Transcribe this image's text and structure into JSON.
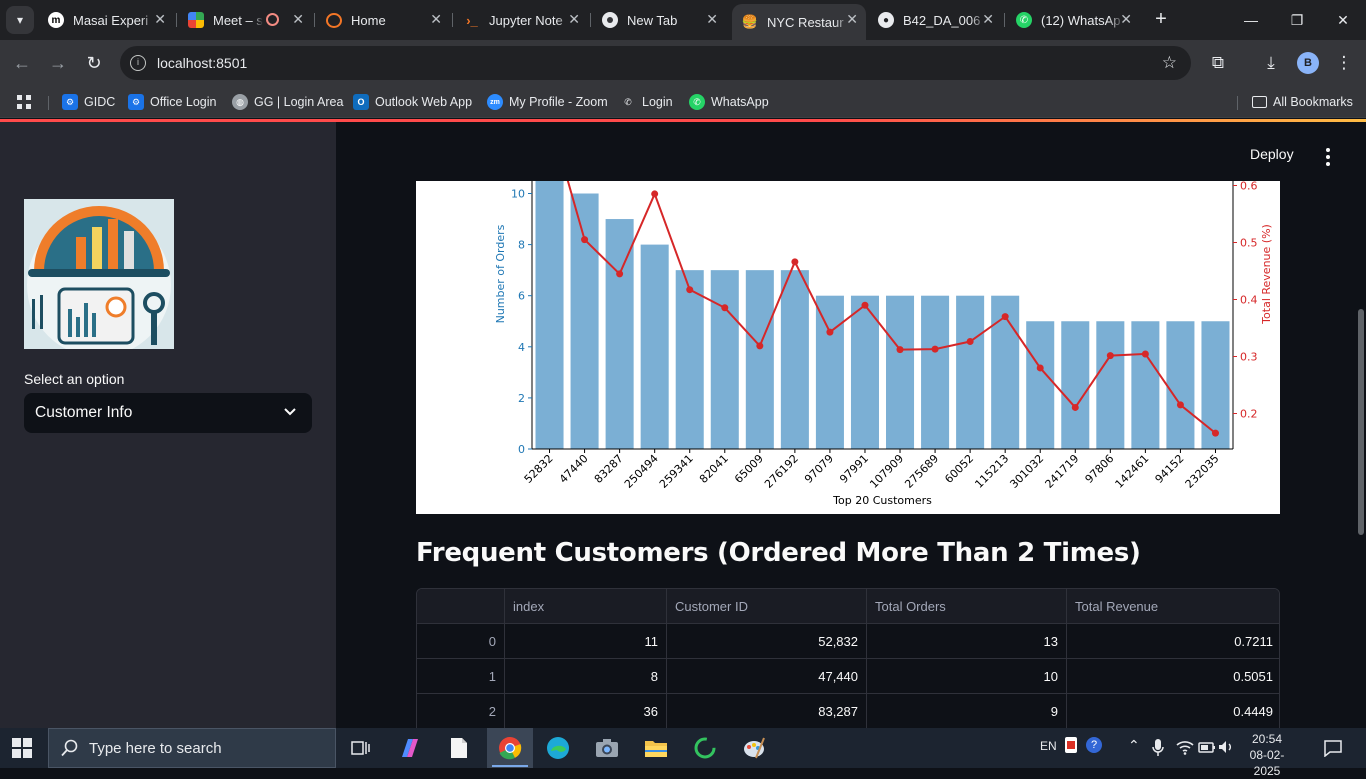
{
  "browser": {
    "tabs": [
      {
        "label": "Masai Experi",
        "icon": "masai-icon"
      },
      {
        "label": "Meet – s",
        "icon": "meet-icon"
      },
      {
        "label": "Home",
        "icon": "jupyter-icon"
      },
      {
        "label": "Jupyter Note",
        "icon": "terminal-icon"
      },
      {
        "label": "New Tab",
        "icon": "chrome-icon"
      },
      {
        "label": "NYC Restaur",
        "icon": "burger-icon"
      },
      {
        "label": "B42_DA_006",
        "icon": "github-icon"
      },
      {
        "label": "(12) WhatsAp",
        "icon": "whatsapp-icon"
      }
    ],
    "url": "localhost:8501",
    "bookmarks": [
      {
        "label": "GIDC"
      },
      {
        "label": "Office Login"
      },
      {
        "label": "GG | Login Area"
      },
      {
        "label": "Outlook Web App"
      },
      {
        "label": "My Profile - Zoom"
      },
      {
        "label": "Login"
      },
      {
        "label": "WhatsApp"
      }
    ],
    "all_bookmarks": "All Bookmarks",
    "profile_initial": "B"
  },
  "app": {
    "header": {
      "deploy": "Deploy"
    },
    "sidebar": {
      "select_label": "Select an option",
      "select_value": "Customer Info"
    },
    "section_title": "Frequent Customers (Ordered More Than 2 Times)",
    "table": {
      "columns": [
        "",
        "index",
        "Customer ID",
        "Total Orders",
        "Total Revenue"
      ],
      "rows": [
        {
          "row": "0",
          "index": "11",
          "customer_id": "52,832",
          "orders": "13",
          "revenue": "0.7211"
        },
        {
          "row": "1",
          "index": "8",
          "customer_id": "47,440",
          "orders": "10",
          "revenue": "0.5051"
        },
        {
          "row": "2",
          "index": "36",
          "customer_id": "83,287",
          "orders": "9",
          "revenue": "0.4449"
        }
      ]
    }
  },
  "chart_data": {
    "type": "bar",
    "xlabel": "Top 20 Customers",
    "ylabel": "Number of Orders",
    "y2label": "Total Revenue (%)",
    "categories": [
      "52832",
      "47440",
      "83287",
      "250494",
      "259341",
      "82041",
      "65009",
      "276192",
      "97079",
      "97991",
      "107909",
      "275689",
      "60052",
      "115213",
      "301032",
      "241719",
      "97806",
      "142461",
      "94152",
      "232035"
    ],
    "series": [
      {
        "name": "Number of Orders",
        "type": "bar",
        "axis": "left",
        "color": "#7bafd4",
        "values": [
          13,
          10,
          9,
          8,
          7,
          7,
          7,
          7,
          6,
          6,
          6,
          6,
          6,
          6,
          5,
          5,
          5,
          5,
          5,
          5
        ]
      },
      {
        "name": "Total Revenue (%)",
        "type": "line",
        "axis": "right",
        "color": "#d62728",
        "values": [
          0.7211,
          0.5051,
          0.4449,
          0.5852,
          0.4172,
          0.3855,
          0.3186,
          0.4661,
          0.3428,
          0.3899,
          0.3121,
          0.313,
          0.3263,
          0.37,
          0.2799,
          0.2106,
          0.3015,
          0.3044,
          0.2151,
          0.1656
        ]
      }
    ],
    "yticks": [
      0,
      2,
      4,
      6,
      8,
      10
    ],
    "y2ticks": [
      0.2,
      0.3,
      0.4,
      0.5,
      0.6
    ],
    "left_axis_color": "#1f77b4",
    "right_axis_color": "#d62728"
  },
  "taskbar": {
    "search_placeholder": "Type here to search",
    "lang": "EN",
    "time": "20:54",
    "date": "08-02-2025"
  }
}
